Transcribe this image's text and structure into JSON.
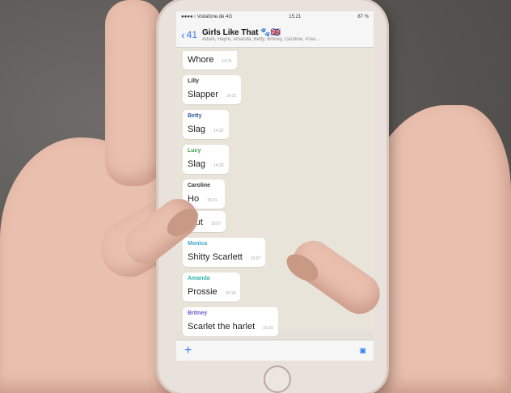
{
  "status_bar": {
    "carrier": "●●●●○ Vodafone.de 4G",
    "time": "15:21",
    "battery": "87 %"
  },
  "nav": {
    "back_count": "41",
    "group_title": "Girls Like That 🐾🇬🇧",
    "members": "Adam, Hayre, Amanda, Betty, Britney, Caroline, Prao..."
  },
  "messages": [
    {
      "sender": "",
      "text": "Whore",
      "time": "14:21",
      "color": "#000000"
    },
    {
      "sender": "Lilly",
      "text": "Slapper",
      "time": "14:21",
      "color": "#333333"
    },
    {
      "sender": "Betty",
      "text": "Slag",
      "time": "14:22",
      "color": "#2b5b9c"
    },
    {
      "sender": "Lucy",
      "text": "Slag",
      "time": "14:23",
      "color": "#3aa142"
    },
    {
      "sender": "Caroline",
      "text": "Ho",
      "time": "15:01",
      "color": "#333333"
    },
    {
      "sender": "",
      "text": "Slut",
      "time": "15:07",
      "color": "#000000"
    },
    {
      "sender": "Monica",
      "text": "Shitty Scarlett",
      "time": "15:07",
      "color": "#3fa3c9"
    },
    {
      "sender": "Amanda",
      "text": "Prossie",
      "time": "15:19",
      "color": "#2fb3ad"
    },
    {
      "sender": "Britney",
      "text": "Scarlet the harlet",
      "time": "15:19",
      "color": "#6a5acd"
    }
  ],
  "icons": {
    "back": "chevron-left-icon",
    "attach": "plus-icon",
    "camera": "camera-icon"
  }
}
